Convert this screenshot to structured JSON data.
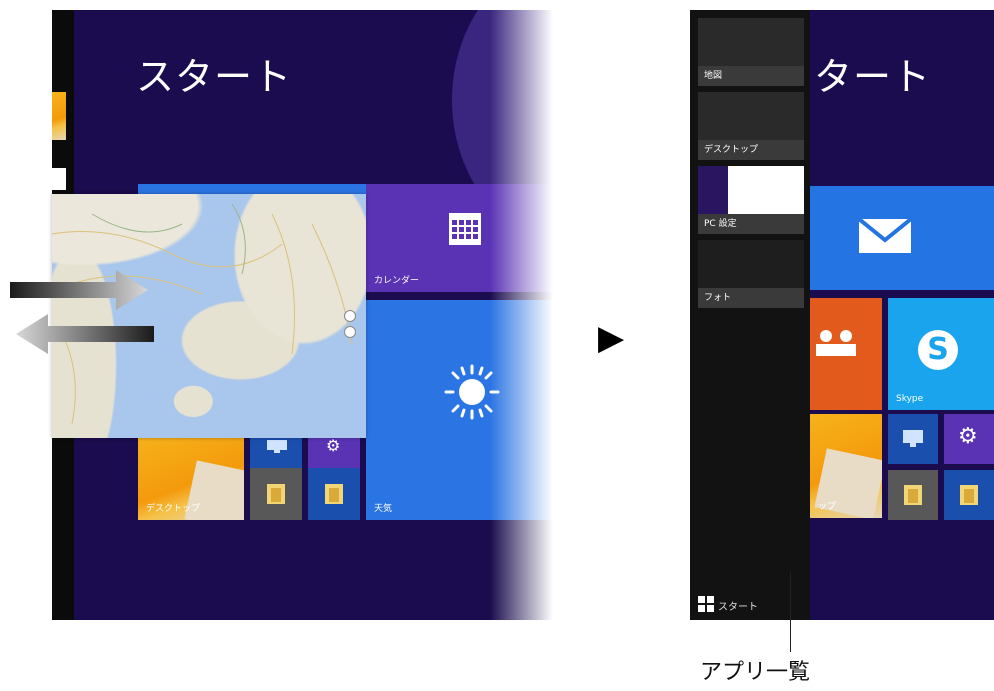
{
  "left": {
    "start_title": "スタート",
    "tiles": {
      "calendar_label": "カレンダー",
      "weather_label": "天気",
      "desktop_label": "デスクトップ"
    }
  },
  "transition_arrow": "▶",
  "right": {
    "start_title": "タート",
    "app_list": {
      "items": [
        {
          "label": "地図"
        },
        {
          "label": "デスクトップ"
        },
        {
          "label": "PC 設定"
        },
        {
          "label": "フォト"
        }
      ],
      "start_label": "スタート"
    },
    "tiles": {
      "skype_label": "Skype",
      "desktop_label": "ップ"
    }
  },
  "callout": "アプリ一覧",
  "colors": {
    "start_bg": "#1a0c4e",
    "calendar_tile": "#5a33b4",
    "weather_tile": "#2b74e3",
    "mail_tile": "#2574e3",
    "people_tile": "#e25a1c",
    "skype_tile": "#1aa4ee",
    "small_blue_tile": "#1b4fae",
    "small_purple_tile": "#5a33b4",
    "small_gray_tile": "#585858"
  }
}
